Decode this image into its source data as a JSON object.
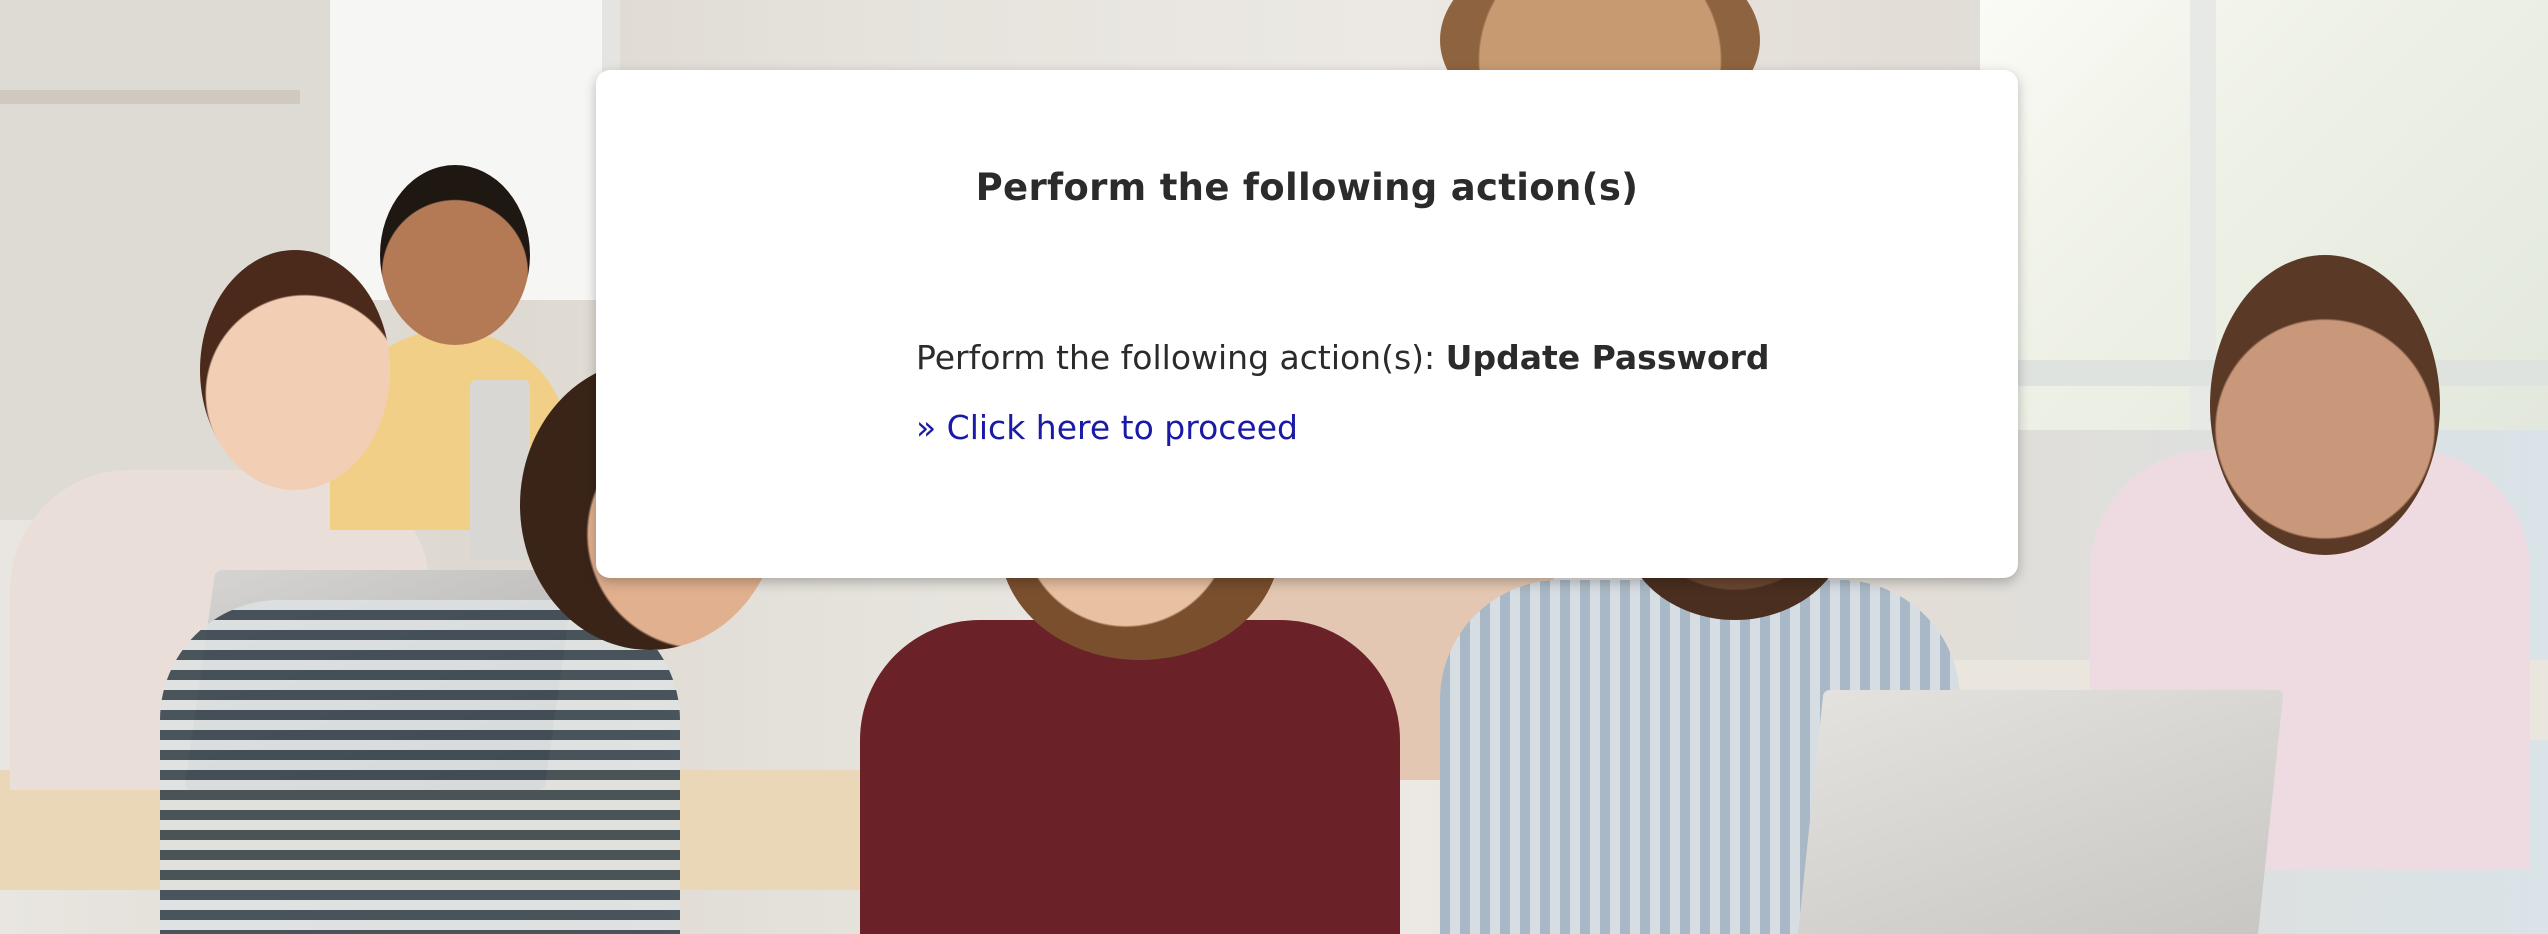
{
  "page": {
    "background_image": "classroom-photo",
    "accent_link_color": "#1a1aa6",
    "text_color": "#2b2b2b",
    "card_color": "#ffffff"
  },
  "dialog": {
    "title": "Perform the following action(s)",
    "action_prefix": "Perform the following action(s):",
    "action_name": "Update Password",
    "proceed_link": "» Click here to proceed"
  }
}
